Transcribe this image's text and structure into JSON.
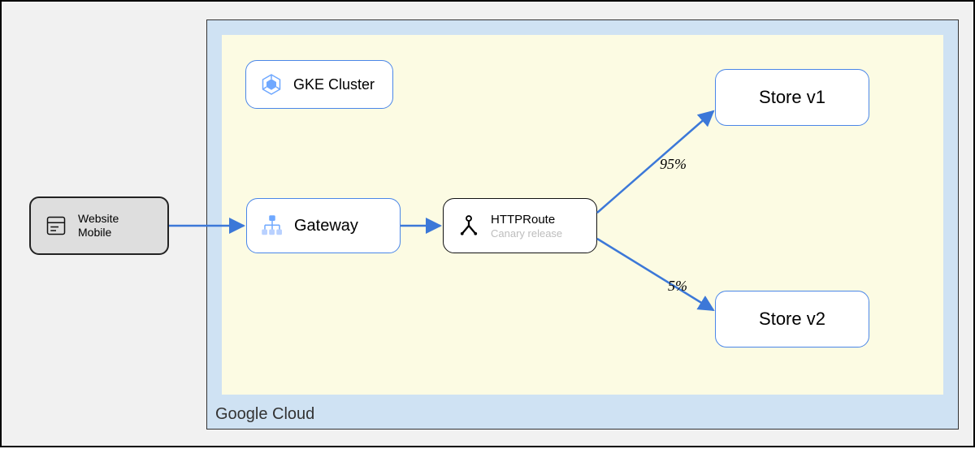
{
  "diagram": {
    "outer_label": "Google Cloud",
    "cluster_label": "GKE Cluster",
    "client": {
      "line1": "Website",
      "line2": "Mobile"
    },
    "gateway": {
      "label": "Gateway"
    },
    "httproute": {
      "label": "HTTPRoute",
      "sub": "Canary release"
    },
    "store_v1": {
      "label": "Store v1"
    },
    "store_v2": {
      "label": "Store v2"
    },
    "edges": {
      "route_to_v1_pct": "95%",
      "route_to_v2_pct": "5%"
    },
    "colors": {
      "arrow": "#3c78d8",
      "blue_border": "#4a86e8"
    },
    "icons": {
      "client": "page-icon",
      "cluster": "gke-icon",
      "gateway": "loadbalancer-icon",
      "httproute": "split-icon"
    }
  }
}
